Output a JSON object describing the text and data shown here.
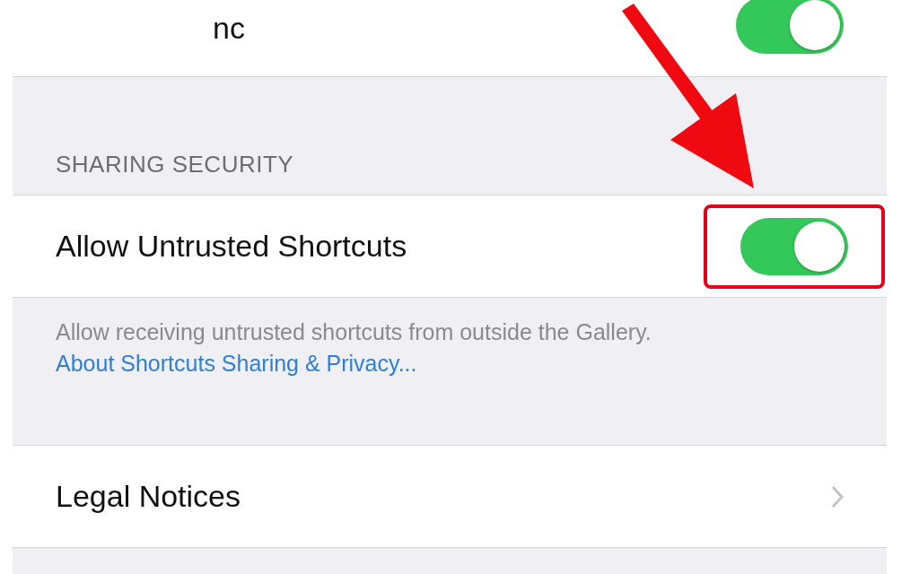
{
  "top_row": {
    "label": "nc",
    "on": true
  },
  "sharing_security": {
    "header": "SHARING SECURITY",
    "row": {
      "label": "Allow Untrusted Shortcuts",
      "on": true,
      "highlighted": true
    },
    "footer": {
      "text": "Allow receiving untrusted shortcuts from outside the Gallery.",
      "link": "About Shortcuts Sharing & Privacy..."
    }
  },
  "legal_row": {
    "label": "Legal Notices"
  },
  "annotation": {
    "kind": "arrow"
  }
}
